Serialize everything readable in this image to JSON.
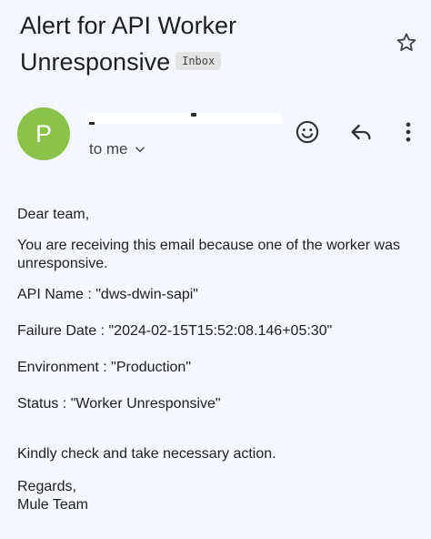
{
  "email": {
    "subject": "Alert for API Worker Unresponsive",
    "label": "Inbox",
    "sender": {
      "avatar_letter": "P",
      "avatar_color": "#8bc34a",
      "recipient_text": "to me"
    },
    "icons": {
      "star": "star-outline-icon",
      "emoji": "emoji-reaction-icon",
      "reply": "reply-icon",
      "more": "more-vert-icon",
      "expand": "chevron-down-icon"
    },
    "body": {
      "greeting": "Dear team,",
      "intro": "You are receiving this email because one of the worker was unresponsive.",
      "api_name": "API Name : \"dws-dwin-sapi\"",
      "failure_date": "Failure Date : \"2024-02-15T15:52:08.146+05:30\"",
      "environment": "Environment : \"Production\"",
      "status": "Status : \"Worker Unresponsive\"",
      "action": "Kindly check and take necessary action.",
      "closing": "Regards,",
      "signature": "Mule Team"
    }
  }
}
